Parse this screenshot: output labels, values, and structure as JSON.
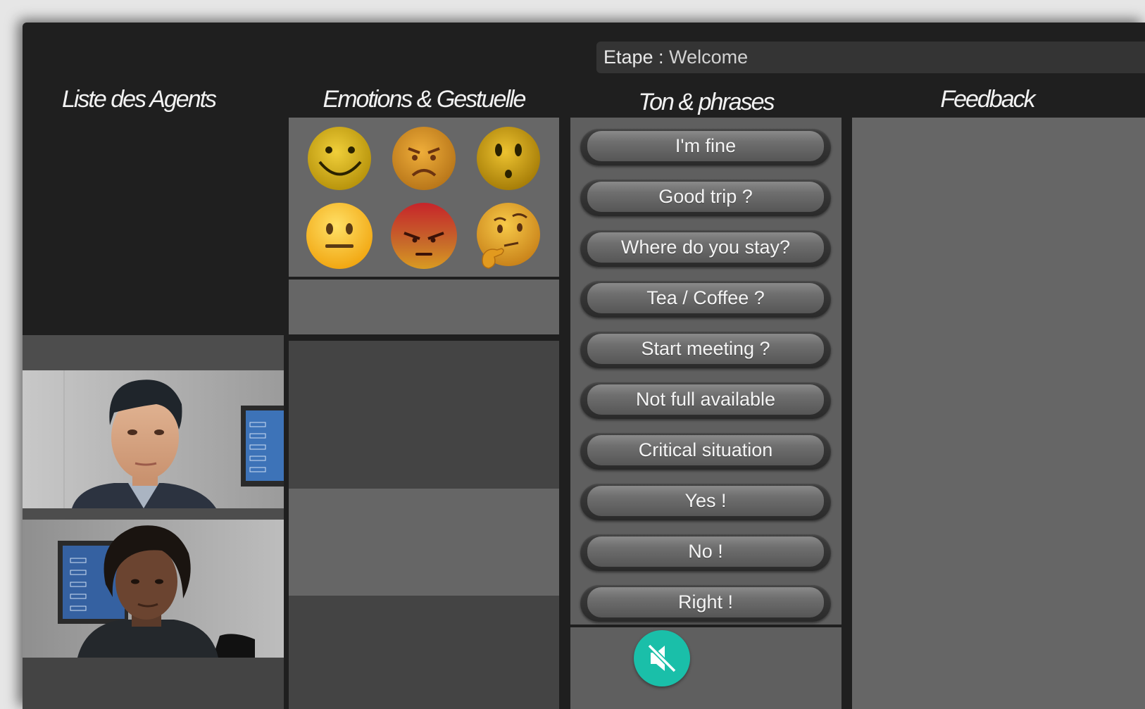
{
  "stage": {
    "label": "Etape :",
    "value": "Welcome"
  },
  "columns": {
    "agents": "Liste des Agents",
    "emotions": "Emotions & Gestuelle",
    "phrases": "Ton & phrases",
    "feedback": "Feedback"
  },
  "emotions": [
    {
      "name": "smile-emoji",
      "color": "#d9b414"
    },
    {
      "name": "annoyed-emoji",
      "color": "#d69a1f"
    },
    {
      "name": "surprised-emoji",
      "color": "#cfa012"
    },
    {
      "name": "neutral-emoji",
      "color": "#fbc723"
    },
    {
      "name": "angry-emoji",
      "color": "#c0392b"
    },
    {
      "name": "thinking-emoji",
      "color": "#e7a623"
    }
  ],
  "phrases": [
    "I'm fine",
    "Good trip ?",
    "Where do you stay?",
    "Tea / Coffee ?",
    "Start meeting ?",
    "Not full available",
    "Critical situation",
    "Yes !",
    "No !",
    "Right !"
  ],
  "agents": [
    {
      "name": "agent-male"
    },
    {
      "name": "agent-female"
    }
  ],
  "mute": {
    "icon": "speaker-muted-icon",
    "color": "#1abfa9"
  }
}
